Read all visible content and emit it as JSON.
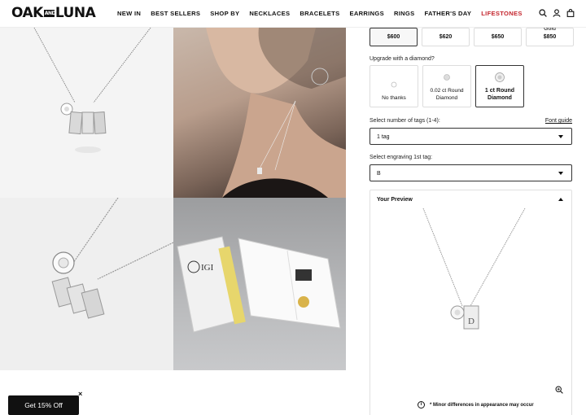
{
  "header": {
    "logo": {
      "left": "OAK",
      "mid": "AND",
      "right": "LUNA"
    },
    "nav": [
      {
        "label": "NEW IN",
        "color": "#111111"
      },
      {
        "label": "BEST SELLERS",
        "color": "#111111"
      },
      {
        "label": "SHOP BY",
        "color": "#111111"
      },
      {
        "label": "NECKLACES",
        "color": "#111111"
      },
      {
        "label": "BRACELETS",
        "color": "#111111"
      },
      {
        "label": "EARRINGS",
        "color": "#111111"
      },
      {
        "label": "RINGS",
        "color": "#111111"
      },
      {
        "label": "FATHER'S DAY",
        "color": "#111111"
      },
      {
        "label": "LIFESTONES",
        "color": "#c4262e"
      }
    ],
    "icons": [
      "search-icon",
      "account-icon",
      "bag-icon"
    ]
  },
  "gallery": {
    "cert_text": "IGI"
  },
  "product": {
    "prices": [
      {
        "value": "$600",
        "selected": true,
        "note": ""
      },
      {
        "value": "$620",
        "selected": false,
        "note": ""
      },
      {
        "value": "$650",
        "selected": false,
        "note": ""
      },
      {
        "value": "$850",
        "selected": false,
        "note": "Gold"
      }
    ],
    "diamond_label": "Upgrade with a diamond?",
    "diamonds": [
      {
        "label": "No thanks",
        "selected": false
      },
      {
        "label": "0.02 ct Round Diamond",
        "selected": false
      },
      {
        "label": "1 ct Round Diamond",
        "selected": true
      }
    ],
    "tags_label": "Select number of tags (1-4):",
    "font_guide": "Font guide",
    "tags_value": "1 tag",
    "engraving_label": "Select engraving 1st tag:",
    "engraving_value": "B",
    "preview_title": "Your Preview",
    "preview_tag_letter": "D",
    "preview_note": "* Minor differences in appearance may occur"
  },
  "promo": {
    "label": "Get 15% Off",
    "close": "×"
  }
}
